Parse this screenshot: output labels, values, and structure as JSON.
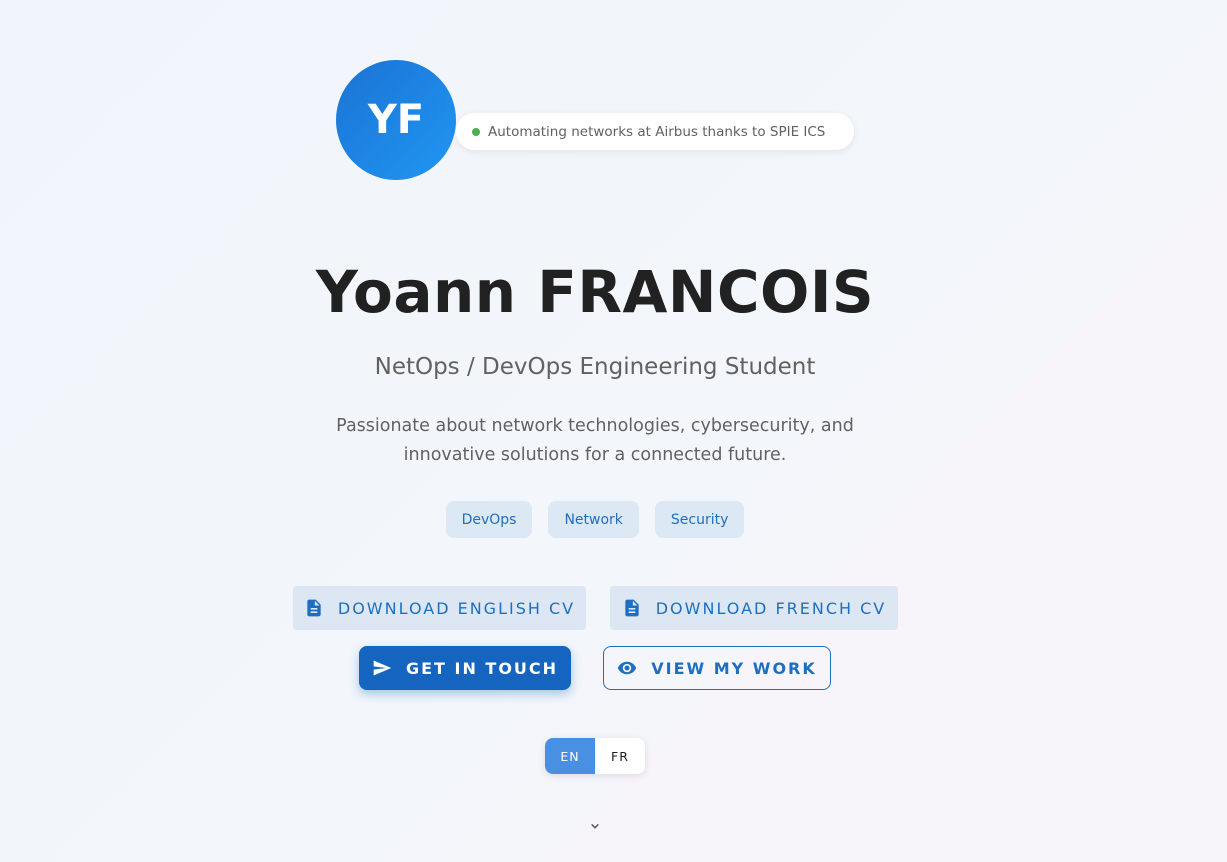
{
  "avatar": {
    "initials": "YF"
  },
  "status": {
    "text": "Automating networks at Airbus thanks to SPIE ICS",
    "dot_color": "#4caf50"
  },
  "hero": {
    "name": "Yoann FRANCOIS",
    "subtitle": "NetOps / DevOps Engineering Student",
    "description": "Passionate about network technologies, cybersecurity, and innovative solutions for a connected future."
  },
  "tags": [
    "DevOps",
    "Network",
    "Security"
  ],
  "actions": {
    "download_en_cv": "DOWNLOAD ENGLISH CV",
    "download_fr_cv": "DOWNLOAD FRENCH CV",
    "get_in_touch": "GET IN TOUCH",
    "view_my_work": "VIEW MY WORK"
  },
  "language": {
    "options": [
      "EN",
      "FR"
    ],
    "selected": "EN"
  },
  "icons": {
    "cv": "document-icon",
    "contact": "send-icon",
    "work": "eye-icon",
    "scroll": "chevron-down-icon"
  },
  "colors": {
    "primary": "#1565c0",
    "accent": "#2196f3",
    "tag_bg": "#dde8f5"
  }
}
